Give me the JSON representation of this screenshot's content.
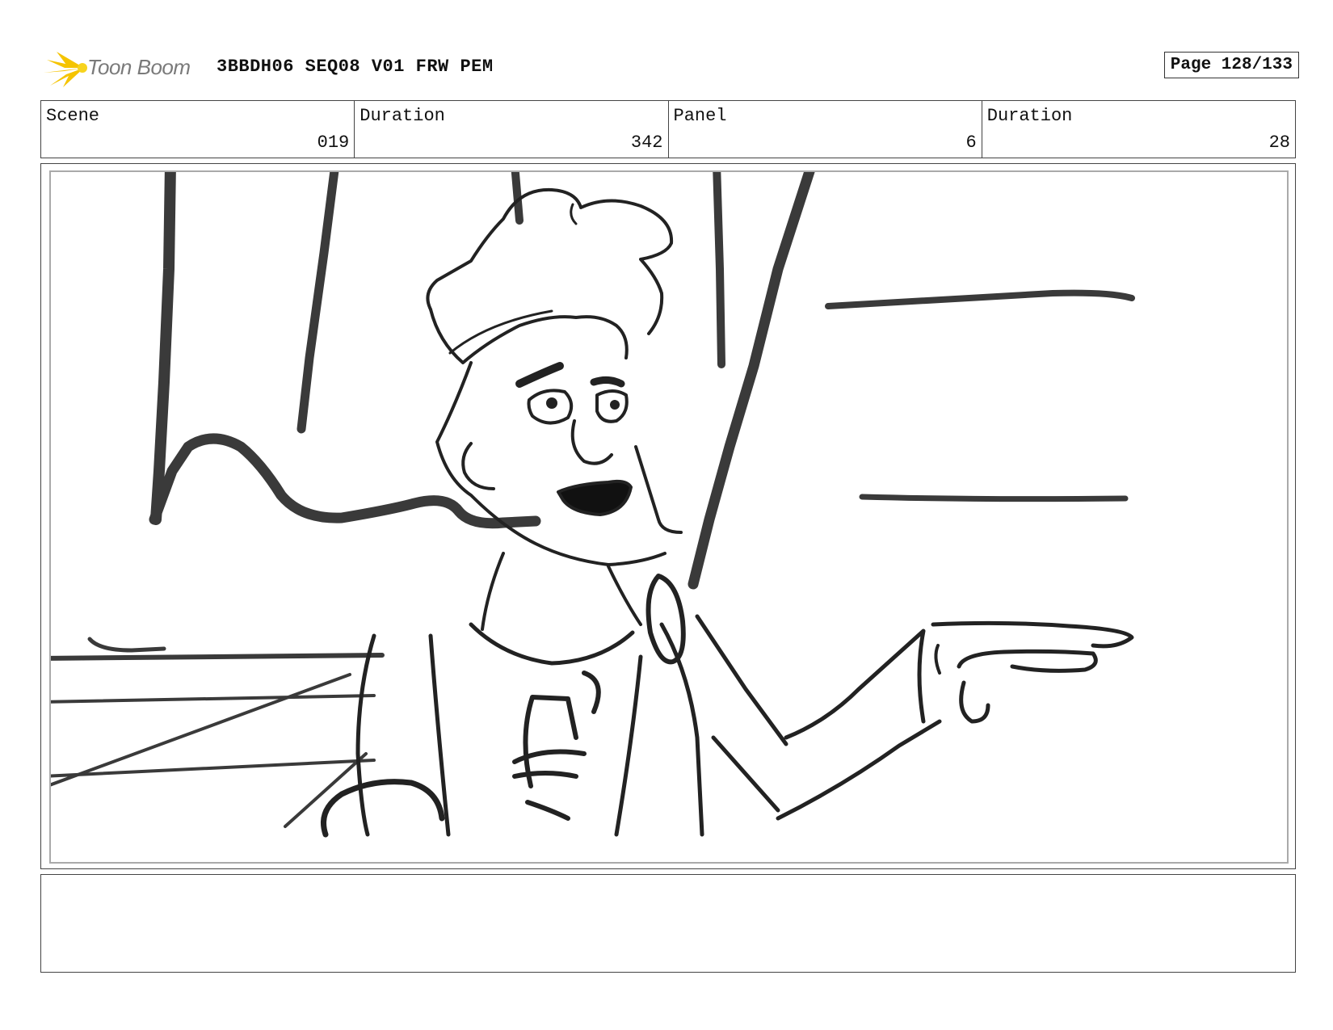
{
  "header": {
    "logo_text": "Toon Boom",
    "title": "3BBDH06 SEQ08 V01 FRW PEM",
    "page": "Page 128/133"
  },
  "info": {
    "scene_label": "Scene",
    "scene_value": "019",
    "scene_duration_label": "Duration",
    "scene_duration_value": "342",
    "panel_label": "Panel",
    "panel_value": "6",
    "panel_duration_label": "Duration",
    "panel_duration_value": "28"
  },
  "notes": {
    "text": ""
  },
  "colors": {
    "logo_accent": "#f5c400",
    "sketch_dark": "#222222",
    "sketch_gray": "#3a3a3a"
  }
}
